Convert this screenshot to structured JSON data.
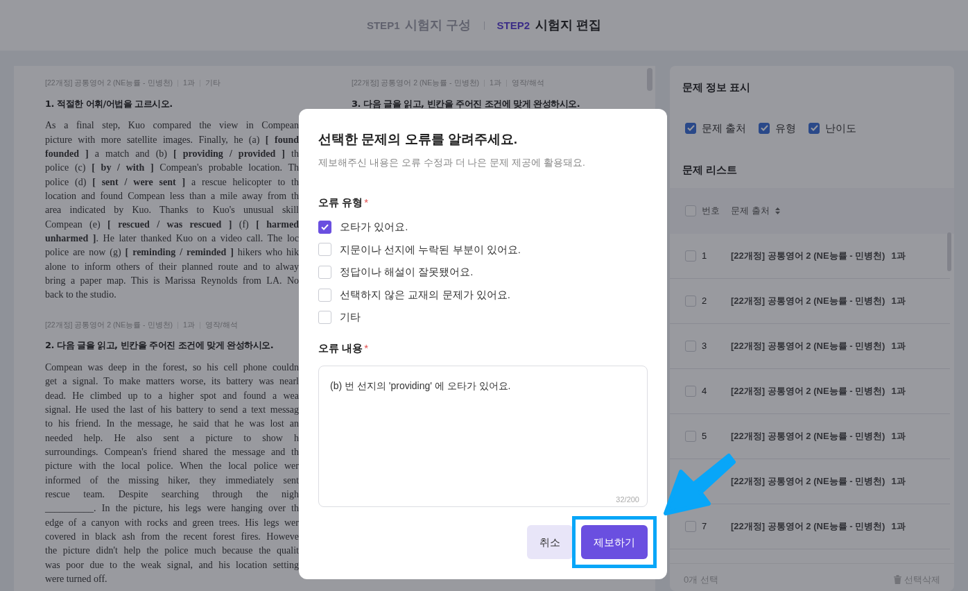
{
  "header": {
    "steps": [
      {
        "label": "STEP1",
        "title": "시험지 구성",
        "selected": false
      },
      {
        "label": "STEP2",
        "title": "시험지 편집",
        "selected": true
      }
    ]
  },
  "columns": [
    {
      "questions": [
        {
          "meta": [
            "[22개정] 공통영어 2 (NE능률 - 민병천)",
            "1과",
            "기타"
          ],
          "title": "1. 적절한 어휘/어법을 고르시오.",
          "lines": [
            "As a final step, Kuo compared the view in Compean",
            "picture with more satellite images. Finally, he (a) **[ found**",
            "**founded ]** a match and (b) **[ providing / provided ]** th",
            "police (c) **[ by / with ]** Compean's probable location. Th",
            "police (d) **[ sent / were sent ]** a rescue helicopter to th",
            "location and found Compean less than a mile away from th",
            "area indicated by Kuo. Thanks to Kuo's unusual skill",
            "Compean (e) **[ rescued / was rescued ]** (f) **[ harmed**",
            "**unharmed ]**. He later thanked Kuo on a video call. The loc",
            "police are now (g) **[ reminding / reminded ]** hikers who hik",
            "alone to inform others of their planned route and to alway",
            "bring a paper map. This is Marissa Reynolds from LA. No",
            "back to the studio."
          ]
        },
        {
          "meta": [
            "[22개정] 공통영어 2 (NE능률 - 민병천)",
            "1과",
            "영작/해석"
          ],
          "title": "2. 다음 글을 읽고, 빈칸을 주어진 조건에 맞게 완성하시오.",
          "lines": [
            "Compean was deep in the forest, so his cell phone couldn",
            "get a signal. To make matters worse, its battery was nearl",
            "dead. He climbed up to a higher spot and found a wea",
            "signal. He used the last of his battery to send a text messag",
            "to his friend. In the message, he said that he was lost an",
            "needed help. He also sent a picture to show h",
            "surroundings. Compean's friend shared the message and th",
            "picture with the local police. When the local police wer",
            "informed of the missing hiker, they immediately sent",
            "rescue team. Despite searching through the nigh",
            "__________. In the picture, his legs were hanging over th",
            "edge of a canyon with rocks and green trees. His legs wer",
            "covered in black ash from the recent forest fires. Howeve",
            "the picture didn't help the police much because the qualit",
            "was poor due to the weak signal, and his location setting",
            "were turned off."
          ]
        }
      ]
    },
    {
      "questions": [
        {
          "meta": [
            "[22개정] 공통영어 2 (NE능률 - 민병천)",
            "1과",
            "영작/해석"
          ],
          "title": "3. 다음 글을 읽고, 빈칸을 주어진 조건에 맞게 완성하시오."
        }
      ]
    }
  ],
  "side_panel": {
    "info_title": "문제 정보 표시",
    "info_options": [
      {
        "label": "문제 출처",
        "checked": true
      },
      {
        "label": "유형",
        "checked": true
      },
      {
        "label": "난이도",
        "checked": true
      }
    ],
    "list_title": "문제 리스트",
    "header_checked": false,
    "number_heading": "번호",
    "source_heading": "문제 출처",
    "rows": [
      {
        "number": "1",
        "source": "[22개정] 공통영어 2 (NE능률 - 민병천)",
        "unit": "1과",
        "checked": false
      },
      {
        "number": "2",
        "source": "[22개정] 공통영어 2 (NE능률 - 민병천)",
        "unit": "1과",
        "checked": false
      },
      {
        "number": "3",
        "source": "[22개정] 공통영어 2 (NE능률 - 민병천)",
        "unit": "1과",
        "checked": false
      },
      {
        "number": "4",
        "source": "[22개정] 공통영어 2 (NE능률 - 민병천)",
        "unit": "1과",
        "checked": false
      },
      {
        "number": "5",
        "source": "[22개정] 공통영어 2 (NE능률 - 민병천)",
        "unit": "1과",
        "checked": false
      },
      {
        "source": "[22개정] 공통영어 2 (NE능률 - 민병천)",
        "unit": "1과"
      },
      {
        "number": "7",
        "source": "[22개정] 공통영어 2 (NE능률 - 민병천)",
        "unit": "1과",
        "checked": false
      }
    ],
    "selected_count": "0개 선택",
    "delete_label": "선택삭제"
  },
  "dialog": {
    "title": "선택한 문제의 오류를 알려주세요.",
    "subtitle": "제보해주신 내용은 오류 수정과 더 나은 문제 제공에 활용돼요.",
    "type_label": "오류 유형",
    "required_mark": "*",
    "options": [
      {
        "label": "오타가 있어요.",
        "checked": true
      },
      {
        "label": "지문이나 선지에 누락된 부분이 있어요.",
        "checked": false
      },
      {
        "label": "정답이나 해설이 잘못됐어요.",
        "checked": false
      },
      {
        "label": "선택하지 않은 교재의 문제가 있어요.",
        "checked": false
      },
      {
        "label": "기타",
        "checked": false
      }
    ],
    "content_label": "오류 내용",
    "content_value": "(b) 번 선지의 'providing' 에 오타가 있어요.",
    "counter": "32/200",
    "buttons": [
      {
        "label": "취소",
        "kind": "secondary",
        "highlighted": false
      },
      {
        "label": "제보하기",
        "kind": "primary",
        "highlighted": true
      }
    ]
  }
}
